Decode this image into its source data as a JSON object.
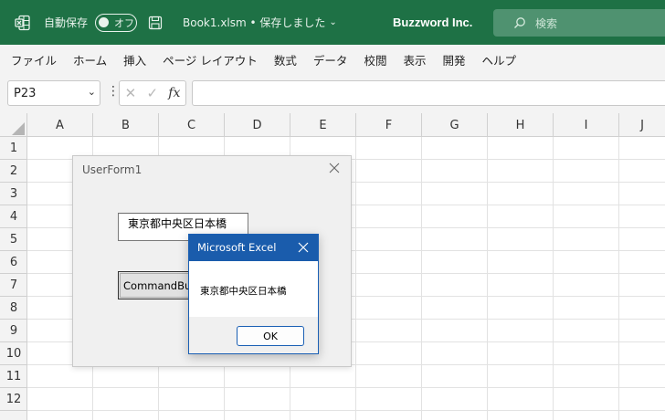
{
  "titlebar": {
    "autosave_label": "自動保存",
    "autosave_toggle": "オフ",
    "document_title": "Book1.xlsm • 保存しました",
    "document_title_chevron": "⌄",
    "company": "Buzzword Inc.",
    "search_placeholder": "検索",
    "background_color": "#1e7145"
  },
  "menu": {
    "items": [
      "ファイル",
      "ホーム",
      "挿入",
      "ページ レイアウト",
      "数式",
      "データ",
      "校閲",
      "表示",
      "開発",
      "ヘルプ"
    ]
  },
  "formula_bar": {
    "name_box": "P23",
    "name_box_dropdown": "⌄",
    "separator": "⋮",
    "cancel_glyph": "✕",
    "enter_glyph": "✓",
    "fx_label": "fx",
    "value": ""
  },
  "grid": {
    "columns": [
      "A",
      "B",
      "C",
      "D",
      "E",
      "F",
      "G",
      "H",
      "I",
      "J"
    ],
    "rows": [
      "1",
      "2",
      "3",
      "4",
      "5",
      "6",
      "7",
      "8",
      "9",
      "10",
      "11",
      "12"
    ]
  },
  "userform": {
    "title": "UserForm1",
    "textbox_value": "東京都中央区日本橋",
    "button_label": "CommandButton1"
  },
  "msgbox": {
    "title": "Microsoft Excel",
    "message": "東京都中央区日本橋",
    "ok_label": "OK",
    "accent_color": "#1a5cac"
  }
}
